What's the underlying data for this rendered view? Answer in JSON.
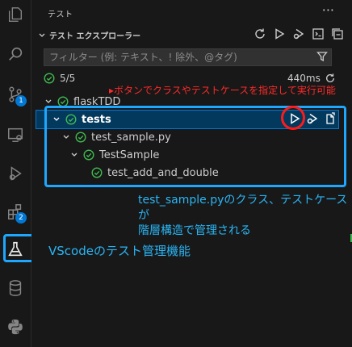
{
  "sidebar": {
    "header": "テスト",
    "more": "···",
    "section_title": "テスト エクスプローラー",
    "filter_placeholder": "フィルター (例: テキスト、! 除外、@タグ)",
    "summary_count": "5/5",
    "summary_time": "440ms"
  },
  "tree": [
    {
      "label": "flaskTDD"
    },
    {
      "label": "tests"
    },
    {
      "label": "test_sample.py"
    },
    {
      "label": "TestSample"
    },
    {
      "label": "test_add_and_double"
    }
  ],
  "annotations": {
    "red_note": "▸ボタンでクラスやテストケースを指定して実行可能",
    "blue_line1": "test_sample.pyのクラス、テストケースが",
    "blue_line2": "階層構造で管理される",
    "main_label": "VScodeのテスト管理機能"
  },
  "activity_bar": {
    "badge_source_control": "1",
    "badge_extensions": "2"
  },
  "colors": {
    "accent": "#0078d4",
    "pass": "#3fb950",
    "annotation_blue": "#29b6f6",
    "annotation_red": "#ff2a2a"
  }
}
